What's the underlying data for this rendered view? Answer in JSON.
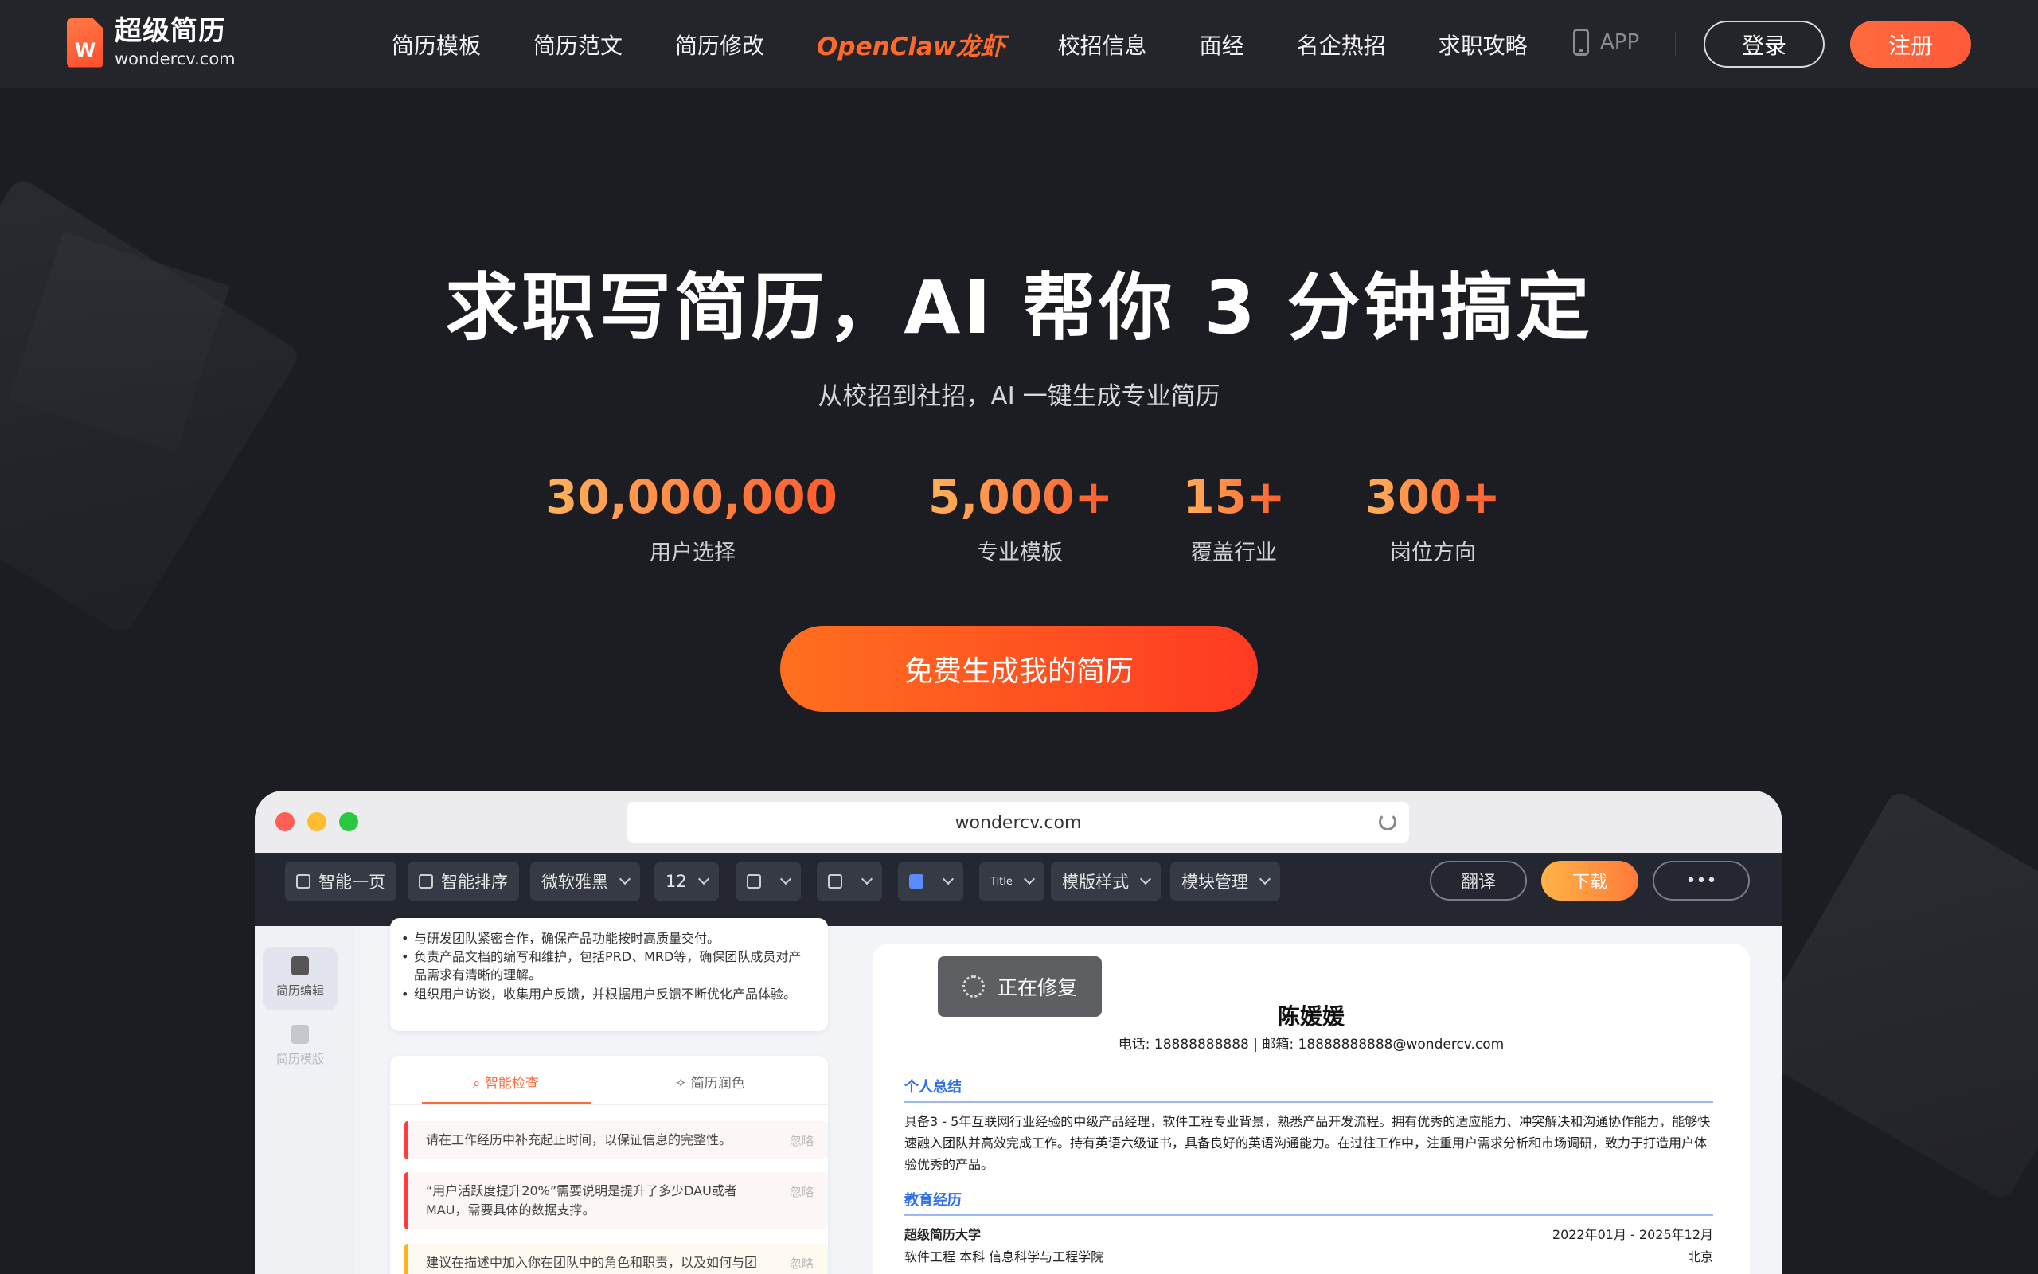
{
  "header": {
    "logo_cn": "超级简历",
    "logo_en": "wondercv.com",
    "logo_mark": "W",
    "nav": [
      "简历模板",
      "简历范文",
      "简历修改",
      "OpenClaw龙虾",
      "校招信息",
      "面经",
      "名企热招",
      "求职攻略"
    ],
    "app_label": "APP",
    "login_label": "登录",
    "register_label": "注册"
  },
  "hero": {
    "title": "求职写简历，AI 帮你 3 分钟搞定",
    "subtitle": "从校招到社招，AI 一键生成专业简历",
    "stats": [
      {
        "value": "30,000,000+",
        "label": "用户选择"
      },
      {
        "value": "5,000+",
        "label": "专业模板"
      },
      {
        "value": "15+",
        "label": "覆盖行业"
      },
      {
        "value": "300+",
        "label": "岗位方向"
      }
    ],
    "cta_label": "免费生成我的简历"
  },
  "mockup": {
    "url": "wondercv.com",
    "toolbar": {
      "smart_page": "智能一页",
      "smart_sort": "智能排序",
      "font": "微软雅黑",
      "font_size": "12",
      "title_icon_text": "Title",
      "template_style": "模版样式",
      "module_manage": "模块管理",
      "translate": "翻译",
      "download": "下载",
      "more": "•••"
    },
    "sidebar": {
      "edit": "简历编辑",
      "template": "简历模版"
    },
    "editor": {
      "bullets": [
        "与研发团队紧密合作，确保产品功能按时高质量交付。",
        "负责产品文档的编写和维护，包括PRD、MRD等，确保团队成员对产品需求有清晰的理解。",
        "组织用户访谈，收集用户反馈，并根据用户反馈不断优化产品体验。"
      ],
      "tab_check": "智能检查",
      "tab_polish": "简历润色",
      "checks": [
        {
          "text": "请在工作经历中补充起止时间，以保证信息的完整性。",
          "action": "忽略"
        },
        {
          "text": "“用户活跃度提升20%”需要说明是提升了多少DAU或者MAU，需要具体的数据支撑。",
          "action": "忽略"
        },
        {
          "text": "建议在描述中加入你在团队中的角色和职责，以及如何与团",
          "action": "忽略"
        }
      ]
    },
    "resume": {
      "status": "正在修复",
      "name": "陈媛媛",
      "contact": "电话: 18888888888 | 邮箱: 18888888888@wondercv.com",
      "summary_title": "个人总结",
      "summary": "具备3 - 5年互联网行业经验的中级产品经理，软件工程专业背景，熟悉产品开发流程。拥有优秀的适应能力、冲突解决和沟通协作能力，能够快速融入团队并高效完成工作。持有英语六级证书，具备良好的英语沟通能力。在过往工作中，注重用户需求分析和市场调研，致力于打造用户体验优秀的产品。",
      "edu_title": "教育经历",
      "school": "超级简历大学",
      "period": "2022年01月 - 2025年12月",
      "major": "软件工程 本科 信息科学与工程学院",
      "city": "北京"
    }
  },
  "colors": {
    "accent": "#ff6a3d",
    "header_bg": "#23252b",
    "page_bg": "#1c1d22",
    "resume_blue": "#2d6ef0"
  }
}
